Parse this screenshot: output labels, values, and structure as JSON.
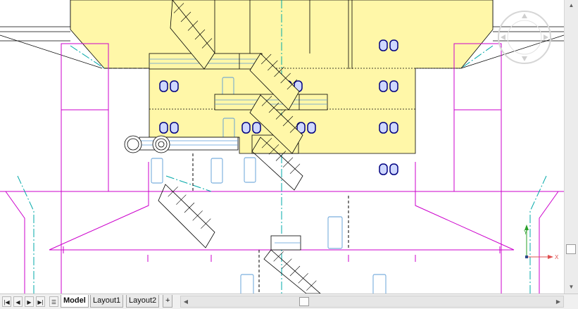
{
  "layout_tabs": {
    "model": "Model",
    "layout1": "Layout1",
    "layout2": "Layout2",
    "add": "+"
  },
  "nav_buttons": [
    "first-tab",
    "previous-tab",
    "next-tab",
    "last-tab"
  ],
  "viewcube": {
    "icon": "viewcube-compass-icon"
  },
  "ucs": {
    "x_label": "X",
    "y_label": "Y"
  },
  "colors": {
    "drawing_background": "#ffffff",
    "room_fill": "#fff7a8",
    "wall_lines": "#cc00cc",
    "centerline": "#00a8a8",
    "windows": "#4a90d9",
    "door_lines": "#000000",
    "ucs_x": "#e05050",
    "ucs_y": "#2aa02a"
  }
}
